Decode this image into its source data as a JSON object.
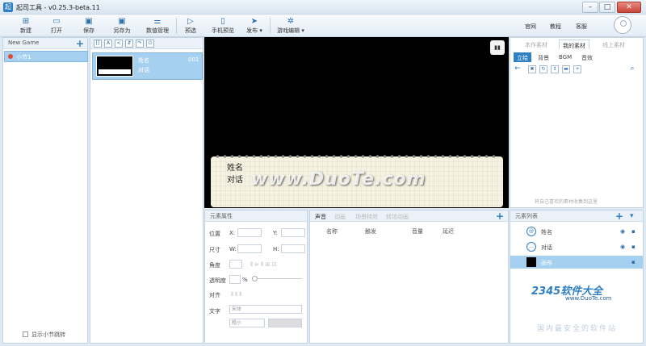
{
  "window": {
    "title": "起司工具 - v0.25.3-beta.11",
    "min": "–",
    "max": "□",
    "close": "✕"
  },
  "toolbar": {
    "buttons": [
      {
        "label": "新建",
        "icon": "plus-square-icon"
      },
      {
        "label": "打开",
        "icon": "folder-icon"
      },
      {
        "label": "保存",
        "icon": "save-icon"
      },
      {
        "label": "另存为",
        "icon": "save-as-icon"
      },
      {
        "label": "数值管理",
        "icon": "sliders-icon"
      },
      {
        "label": "预选",
        "icon": "play-icon"
      },
      {
        "label": "手机预览",
        "icon": "mobile-icon"
      },
      {
        "label": "发布 ▾",
        "icon": "send-icon"
      },
      {
        "label": "游戏编辑 ▾",
        "icon": "gear-icon"
      }
    ],
    "links": [
      "官网",
      "教程",
      "客服"
    ]
  },
  "left": {
    "header": "New Game",
    "scene": "小节1",
    "show_toggle": "显示小节跳转"
  },
  "node": {
    "name": "姓名",
    "dialog": "对话",
    "number": "001"
  },
  "stage": {
    "name_text": "姓名",
    "dialog_text": "对话",
    "watermark": "www.DuoTe.com"
  },
  "materials": {
    "tabs": [
      "本作素材",
      "我的素材",
      "线上素材"
    ],
    "subtabs": [
      "立绘",
      "背景",
      "BGM",
      "音效"
    ],
    "drop_note": "将自己喜欢的素材收集到这里"
  },
  "attrs": {
    "title": "元素属性",
    "position": "位置",
    "x": "X:",
    "y": "Y:",
    "size": "尺寸",
    "w": "W:",
    "h": "H:",
    "angle": "角度",
    "opacity": "透明度",
    "percent": "%",
    "align": "对齐",
    "text": "文字",
    "font_placeholder": "宋体",
    "size_placeholder": "粗小"
  },
  "sound": {
    "tabs": [
      "声音",
      "动画",
      "场景特效",
      "转场动画"
    ],
    "columns": [
      "名称",
      "触发",
      "音量",
      "延迟"
    ]
  },
  "elements": {
    "title": "元素列表",
    "items": [
      {
        "name": "姓名",
        "icon": "name-icon"
      },
      {
        "name": "对话",
        "icon": "dialog-icon"
      },
      {
        "name": "画布",
        "icon": "canvas-icon"
      }
    ]
  },
  "logo": {
    "main": "2345软件大全",
    "sub": "www.DuoTe.com",
    "cn": "国内最安全的软件站"
  }
}
